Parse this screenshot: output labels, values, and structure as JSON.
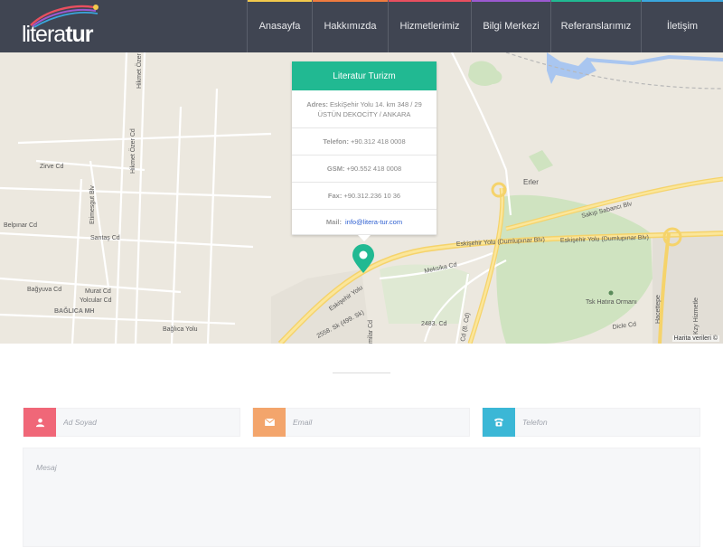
{
  "brand": {
    "logo_light": "litera",
    "logo_bold": "tur"
  },
  "nav": {
    "items": [
      {
        "label": "Anasayfa",
        "color": "#f2c94c"
      },
      {
        "label": "Hakkımızda",
        "color": "#f07b3f"
      },
      {
        "label": "Hizmetlerimiz",
        "color": "#e94f5f"
      },
      {
        "label": "Bilgi Merkezi",
        "color": "#9b59d0"
      },
      {
        "label": "Referanslarımız",
        "color": "#21b992"
      },
      {
        "label": "İletişim",
        "color": "#3aa6dd"
      }
    ]
  },
  "map": {
    "labels": {
      "erler": "Erler",
      "sakip": "Sakıp Sabancı Blv",
      "eskisehir_yolu_dumlupinar_1": "Eskişehir Yolu (Dumlupınar Blv)",
      "eskisehir_yolu_dumlupinar_2": "Eskişehir Yolu (Dumlupınar Blv)",
      "eskisehir_yolu": "Eskişehir Yolu",
      "meksika": "Meksika Cd",
      "tsk": "Tsk Hatıra Ormanı",
      "dicle": "Dicle Cd",
      "hacettepe": "Hacettepe",
      "kzy": "Kzy Hizmetle",
      "hikmet_ozer_1": "Hikmet Özer Cd",
      "hikmet_ozer_2": "Hikmet Özer Cd",
      "zirve": "Zirve Cd",
      "etimesgut": "Etimesgut Blv",
      "belpinar": "Belpınar Cd",
      "santas": "Santaş Cd",
      "bagyuva": "Bağyuva Cd",
      "murat": "Murat Cd",
      "yolcular": "Yolcular Cd",
      "baglica_mh": "BAĞLICA MH",
      "baglica_yolu": "Bağlıca Yolu",
      "sk2558": "2558. Sk (499. Sk)",
      "c2483": "2483. Cd",
      "cd8": "Cd (8. Cd)",
      "milar": "milar Cd"
    },
    "attribution": "Harita verileri ©"
  },
  "info_card": {
    "title": "Literatur Turizm",
    "address_label": "Adres:",
    "address_value": "EskiŞehir Yolu 14. km 348 / 29 ÜSTÜN DEKOCİTY / ANKARA",
    "phone_label": "Telefon:",
    "phone_value": "+90.312 418 0008",
    "gsm_label": "GSM:",
    "gsm_value": "+90.552 418 0008",
    "fax_label": "Fax:",
    "fax_value": "+90.312.236 10 36",
    "mail_label": "Mail:",
    "mail_value": "info@litera-tur.com"
  },
  "form": {
    "name_placeholder": "Ad Soyad",
    "email_placeholder": "Email",
    "phone_placeholder": "Telefon",
    "message_placeholder": "Mesaj",
    "name_color": "#f06778",
    "email_color": "#f3a56c",
    "phone_color": "#3bb7d6"
  }
}
